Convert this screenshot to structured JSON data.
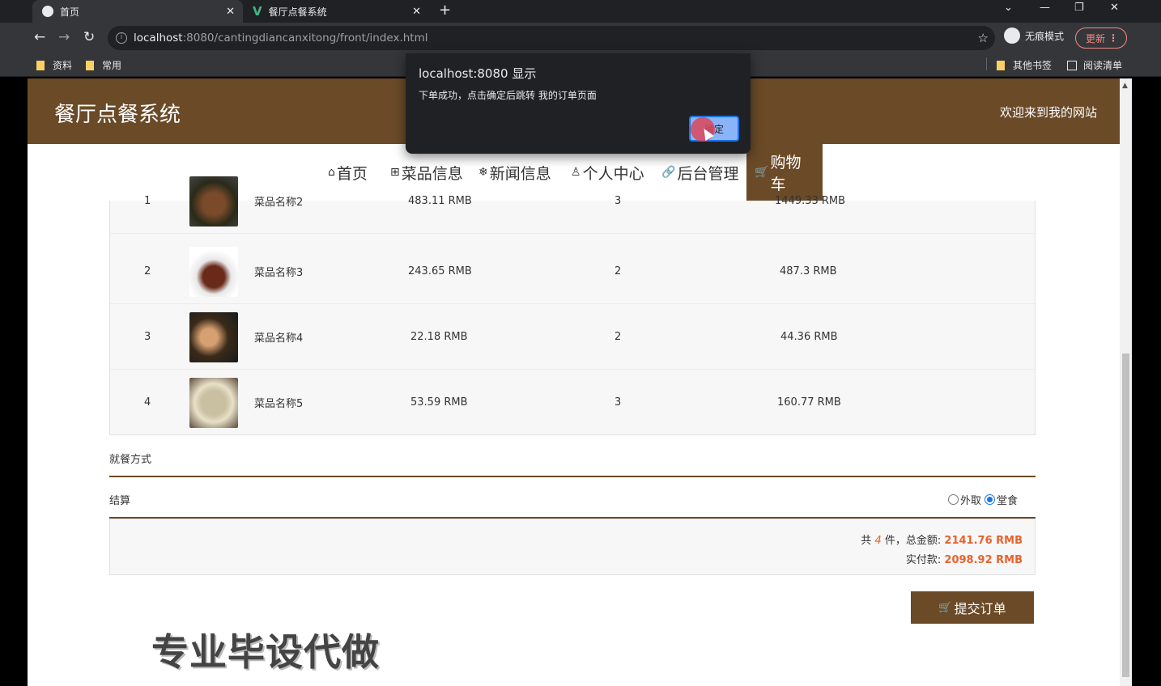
{
  "browser": {
    "tabs": [
      {
        "title": "首页",
        "active": true
      },
      {
        "title": "餐厅点餐系统",
        "active": false
      }
    ],
    "url_host": "localhost",
    "url_path": ":8080/cantingdiancanxitong/front/index.html",
    "incognito_label": "无痕模式",
    "update_label": "更新",
    "bookmarks": [
      "资料",
      "常用"
    ],
    "bookmarks_right": [
      "其他书签",
      "阅读清单"
    ]
  },
  "alert": {
    "title": "localhost:8080 显示",
    "message": "下单成功，点击确定后跳转 我的订单页面",
    "ok_label": "确定"
  },
  "header": {
    "site_title": "餐厅点餐系统",
    "welcome": "欢迎来到我的网站"
  },
  "nav": [
    {
      "label": "首页",
      "icon": "home-icon",
      "glyph": "⌂"
    },
    {
      "label": "菜品信息",
      "icon": "gift-icon",
      "glyph": "⊞"
    },
    {
      "label": "新闻信息",
      "icon": "snowflake-icon",
      "glyph": "❄"
    },
    {
      "label": "个人中心",
      "icon": "user-icon",
      "glyph": "♙"
    },
    {
      "label": "后台管理",
      "icon": "link-icon",
      "glyph": "🔗"
    },
    {
      "label": "购物车",
      "icon": "cart-icon",
      "glyph": "🛒",
      "active": true
    }
  ],
  "cart_rows": [
    {
      "index": "1",
      "name": "菜品名称2",
      "price": "483.11 RMB",
      "qty": "3",
      "subtotal": "1449.33 RMB",
      "img_color": "#5a3a2a"
    },
    {
      "index": "2",
      "name": "菜品名称3",
      "price": "243.65 RMB",
      "qty": "2",
      "subtotal": "487.3 RMB",
      "img_color": "#7a3a1a"
    },
    {
      "index": "3",
      "name": "菜品名称4",
      "price": "22.18 RMB",
      "qty": "2",
      "subtotal": "44.36 RMB",
      "img_color": "#b48a5a"
    },
    {
      "index": "4",
      "name": "菜品名称5",
      "price": "53.59 RMB",
      "qty": "3",
      "subtotal": "160.77 RMB",
      "img_color": "#c8b48a"
    }
  ],
  "dining_label": "就餐方式",
  "checkout_label": "结算",
  "dining_options": [
    {
      "label": "外取",
      "selected": false
    },
    {
      "label": "堂食",
      "selected": true
    }
  ],
  "summary": {
    "prefix": "共",
    "count": "4",
    "count_suffix": "件，总金额:",
    "total": "2141.76 RMB",
    "paid_label": "实付款:",
    "paid": "2098.92 RMB"
  },
  "submit_label": "提交订单",
  "watermark": "专业毕设代做"
}
